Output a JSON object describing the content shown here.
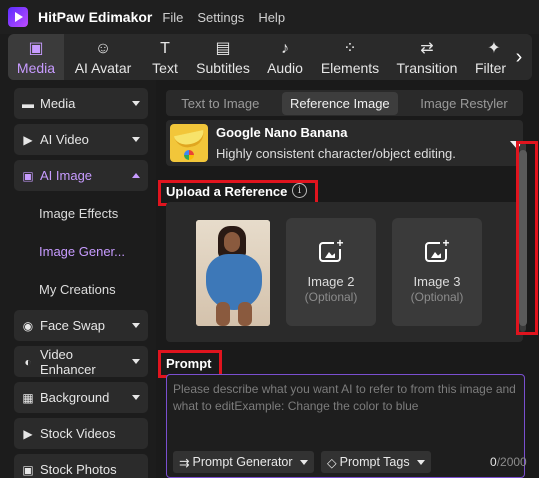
{
  "app": {
    "name": "HitPaw Edimakor",
    "menu": [
      "File",
      "Settings",
      "Help"
    ]
  },
  "toolbar": {
    "items": [
      {
        "label": "Media",
        "icon": "media-icon",
        "glyph": "▣",
        "active": true
      },
      {
        "label": "AI Avatar",
        "icon": "ai-avatar-icon",
        "glyph": "☺"
      },
      {
        "label": "Text",
        "icon": "text-icon",
        "glyph": "T"
      },
      {
        "label": "Subtitles",
        "icon": "subtitles-icon",
        "glyph": "▤"
      },
      {
        "label": "Audio",
        "icon": "audio-icon",
        "glyph": "♪"
      },
      {
        "label": "Elements",
        "icon": "elements-icon",
        "glyph": "⁘"
      },
      {
        "label": "Transition",
        "icon": "transition-icon",
        "glyph": "⇄"
      },
      {
        "label": "Filters",
        "icon": "filters-icon",
        "glyph": "✦"
      }
    ],
    "more_icon": "chevron-right-icon"
  },
  "sidebar": {
    "items": [
      {
        "label": "Media",
        "glyph": "▬",
        "caret": "down"
      },
      {
        "label": "AI Video",
        "glyph": "▶",
        "caret": "down"
      },
      {
        "label": "AI Image",
        "glyph": "▣",
        "caret": "up",
        "active": true
      },
      {
        "label": "Face Swap",
        "glyph": "◉",
        "caret": "down"
      },
      {
        "label": "Video Enhancer",
        "glyph": "◐",
        "caret": "down"
      },
      {
        "label": "Background",
        "glyph": "▦",
        "caret": "down"
      },
      {
        "label": "Stock Videos",
        "glyph": "▶"
      },
      {
        "label": "Stock Photos",
        "glyph": "▣"
      }
    ],
    "subitems": [
      {
        "label": "Image Effects"
      },
      {
        "label": "Image Gener...",
        "active": true
      },
      {
        "label": "My Creations"
      }
    ]
  },
  "tabs": [
    "Text to Image",
    "Reference Image",
    "Image Restyler"
  ],
  "active_tab": "Reference Image",
  "model": {
    "name": "Google Nano Banana",
    "description": "Highly consistent character/object editing."
  },
  "reference": {
    "title": "Upload a Reference",
    "info_glyph": "i",
    "slots": [
      {
        "label": "Image 2",
        "optional": "(Optional)"
      },
      {
        "label": "Image 3",
        "optional": "(Optional)"
      }
    ]
  },
  "prompt": {
    "title": "Prompt",
    "placeholder": "Please describe what you want AI to refer to from this image and what to editExample: Change the color to blue",
    "generator_label": "Prompt Generator",
    "tags_label": "Prompt Tags",
    "count": "0",
    "max": "/2000"
  },
  "colors": {
    "accent": "#c79bff",
    "highlight": "#e0141e",
    "panel": "#2a2a2a"
  }
}
